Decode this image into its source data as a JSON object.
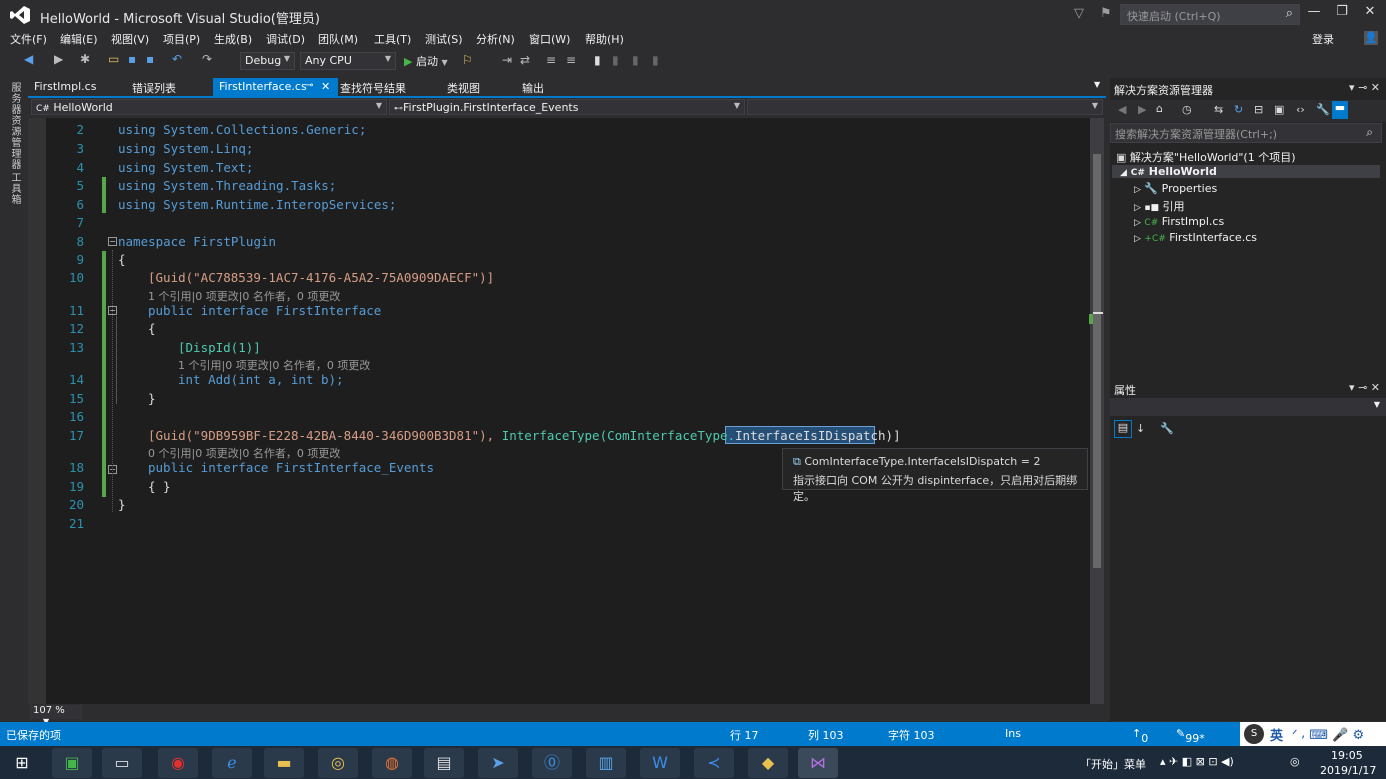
{
  "window": {
    "title": "HelloWorld - Microsoft Visual Studio(管理员)",
    "quick_launch_placeholder": "快速启动 (Ctrl+Q)",
    "login": "登录"
  },
  "menu": [
    "文件(F)",
    "编辑(E)",
    "视图(V)",
    "项目(P)",
    "生成(B)",
    "调试(D)",
    "团队(M)",
    "工具(T)",
    "测试(S)",
    "分析(N)",
    "窗口(W)",
    "帮助(H)"
  ],
  "toolbar": {
    "config": "Debug",
    "platform": "Any CPU",
    "start_label": "启动"
  },
  "left_tools": [
    "服务器资源管理器",
    "工具箱"
  ],
  "tabs": [
    "FirstImpl.cs",
    "错误列表",
    "FirstInterface.cs",
    "查找符号结果",
    "类视图",
    "输出"
  ],
  "active_tab": "FirstInterface.cs",
  "nav": {
    "project": "HelloWorld",
    "member": "FirstPlugin.FirstInterface_Events"
  },
  "code": {
    "line2": "using System.Collections.Generic;",
    "line3": "using System.Linq;",
    "line4": "using System.Text;",
    "line5": "using System.Threading.Tasks;",
    "line6": "using System.Runtime.InteropServices;",
    "line8": "namespace FirstPlugin",
    "line9": "{",
    "line10": "[Guid(\"AC788539-1AC7-4176-A5A2-75A0909DAECF\")]",
    "lens10": "1 个引用|0 项更改|0 名作者，0 项更改",
    "line11": "public interface FirstInterface",
    "line12": "{",
    "line13": "[DispId(1)]",
    "lens13": "1 个引用|0 项更改|0 名作者，0 项更改",
    "line14": "int Add(int a, int b);",
    "line15": "}",
    "line17a": "[Guid(\"9DB959BF-E228-42BA-8440-346D900B3D81\"), ",
    "line17b": "InterfaceType",
    "line17c": "(ComInterfaceType.",
    "line17d": "InterfaceIsIDispatch",
    "line17e": ")]",
    "lens17": "0 个引用|0 项更改|0 名作者，0 项更改",
    "line18": "public interface FirstInterface_Events",
    "line19": "{ }",
    "line20": "}"
  },
  "line_numbers": [
    "2",
    "3",
    "4",
    "5",
    "6",
    "7",
    "8",
    "9",
    "10",
    "11",
    "12",
    "13",
    "14",
    "15",
    "16",
    "17",
    "18",
    "19",
    "20",
    "21"
  ],
  "tooltip": {
    "signature": "ComInterfaceType.InterfaceIsIDispatch = 2",
    "description": "指示接口向 COM 公开为 dispinterface，只启用对后期绑定。"
  },
  "zoom": "107 %",
  "solution_explorer": {
    "title": "解决方案资源管理器",
    "search_placeholder": "搜索解决方案资源管理器(Ctrl+;)",
    "solution": "解决方案\"HelloWorld\"(1 个项目)",
    "project": "HelloWorld",
    "items": [
      "Properties",
      "引用",
      "FirstImpl.cs",
      "FirstInterface.cs"
    ]
  },
  "properties": {
    "title": "属性"
  },
  "status": {
    "saved": "已保存的项",
    "line": "行 17",
    "col": "列 103",
    "char": "字符 103",
    "mode": "Ins",
    "up": "0",
    "pen": "99*",
    "ime": "英"
  },
  "taskbar": {
    "start_menu": "「开始」菜单",
    "time": "19:05",
    "date": "2019/1/17"
  }
}
